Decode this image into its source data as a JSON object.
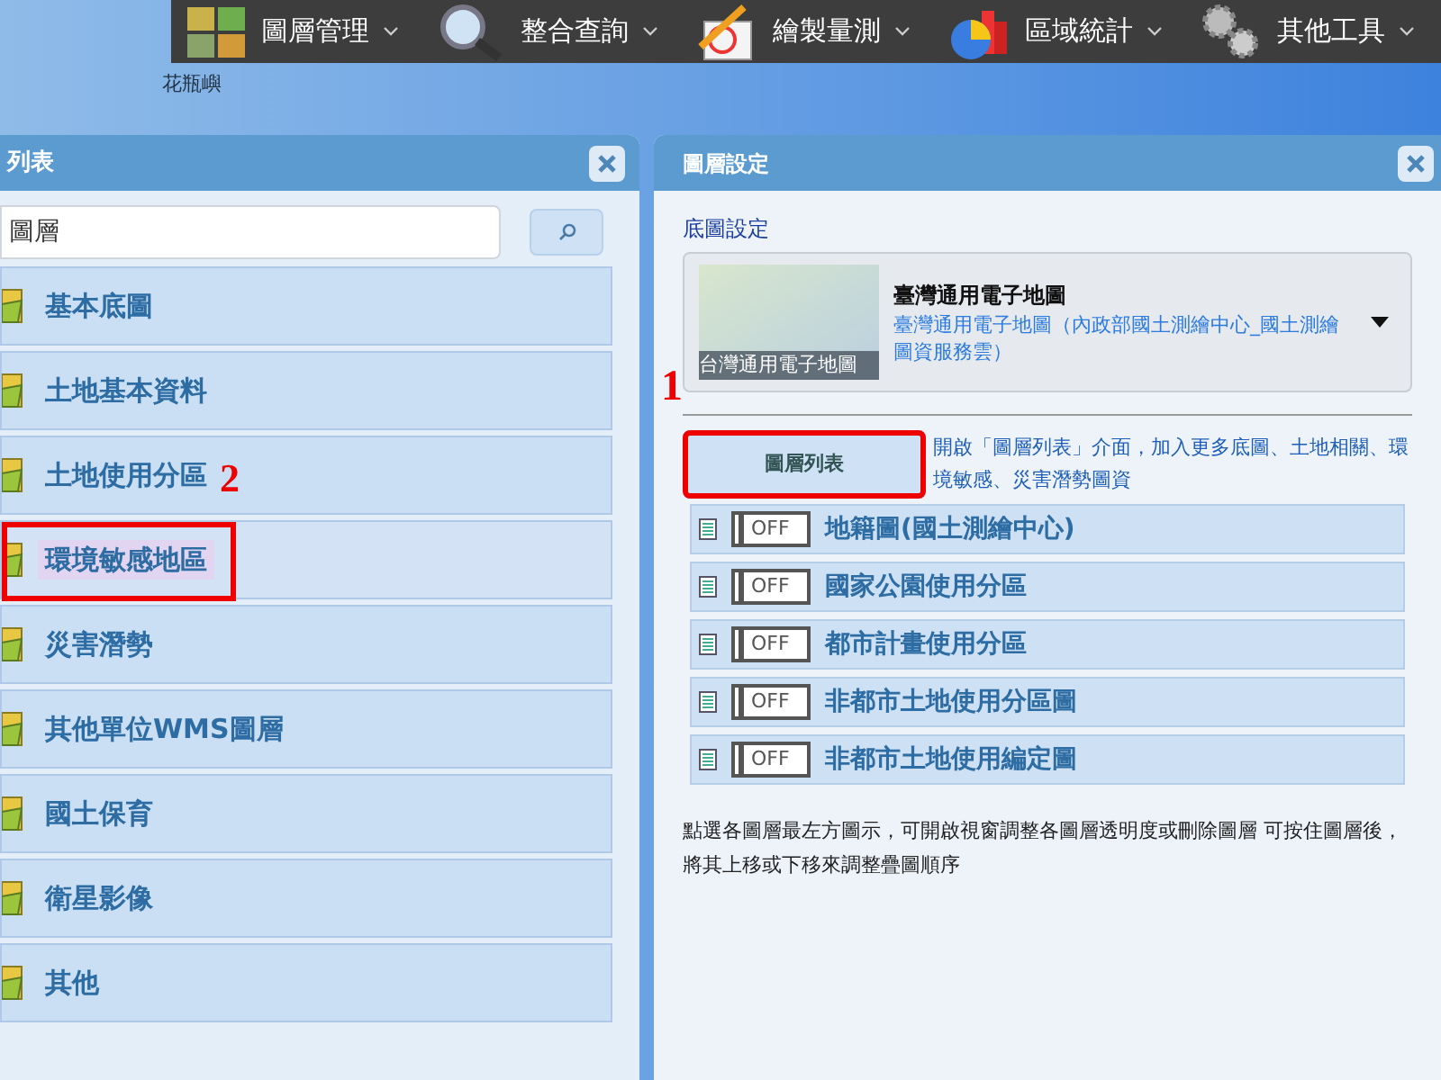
{
  "menu": [
    {
      "label": "圖層管理"
    },
    {
      "label": "整合查詢"
    },
    {
      "label": "繪製量測"
    },
    {
      "label": "區域統計"
    },
    {
      "label": "其他工具"
    }
  ],
  "map_label": "花瓶嶼",
  "left_panel": {
    "title": "列表",
    "search": {
      "value": "圖層"
    },
    "annotation": "2",
    "categories": [
      {
        "label": "基本底圖",
        "highlighted": false
      },
      {
        "label": "土地基本資料",
        "highlighted": false
      },
      {
        "label": "土地使用分區",
        "highlighted": false
      },
      {
        "label": "環境敏感地區",
        "highlighted": true
      },
      {
        "label": "災害潛勢",
        "highlighted": false
      },
      {
        "label": "其他單位WMS圖層",
        "highlighted": false
      },
      {
        "label": "國土保育",
        "highlighted": false
      },
      {
        "label": "衛星影像",
        "highlighted": false
      },
      {
        "label": "其他",
        "highlighted": false
      }
    ]
  },
  "right_panel": {
    "title": "圖層設定",
    "basemap_heading": "底圖設定",
    "basemap": {
      "caption": "台灣通用電子地圖",
      "name": "臺灣通用電子地圖",
      "description": "臺灣通用電子地圖（內政部國土測繪中心_國土測繪圖資服務雲）"
    },
    "annotation": "1",
    "layer_list_button": {
      "label": "圖層列表",
      "highlighted": true
    },
    "layer_list_hint": "開啟「圖層列表」介面，加入更多底圖、土地相關、環境敏感、災害潛勢圖資",
    "layers": [
      {
        "name": "地籍圖(國土測繪中心)",
        "toggle": "OFF",
        "on": false
      },
      {
        "name": "國家公園使用分區",
        "toggle": "OFF",
        "on": false
      },
      {
        "name": "都市計畫使用分區",
        "toggle": "OFF",
        "on": false
      },
      {
        "name": "非都市土地使用分區圖",
        "toggle": "OFF",
        "on": false
      },
      {
        "name": "非都市土地使用編定圖",
        "toggle": "OFF",
        "on": false
      }
    ],
    "note": "點選各圖層最左方圖示，可開啟視窗調整各圖層透明度或刪除圖層 可按住圖層後，將其上移或下移來調整疊圖順序"
  }
}
